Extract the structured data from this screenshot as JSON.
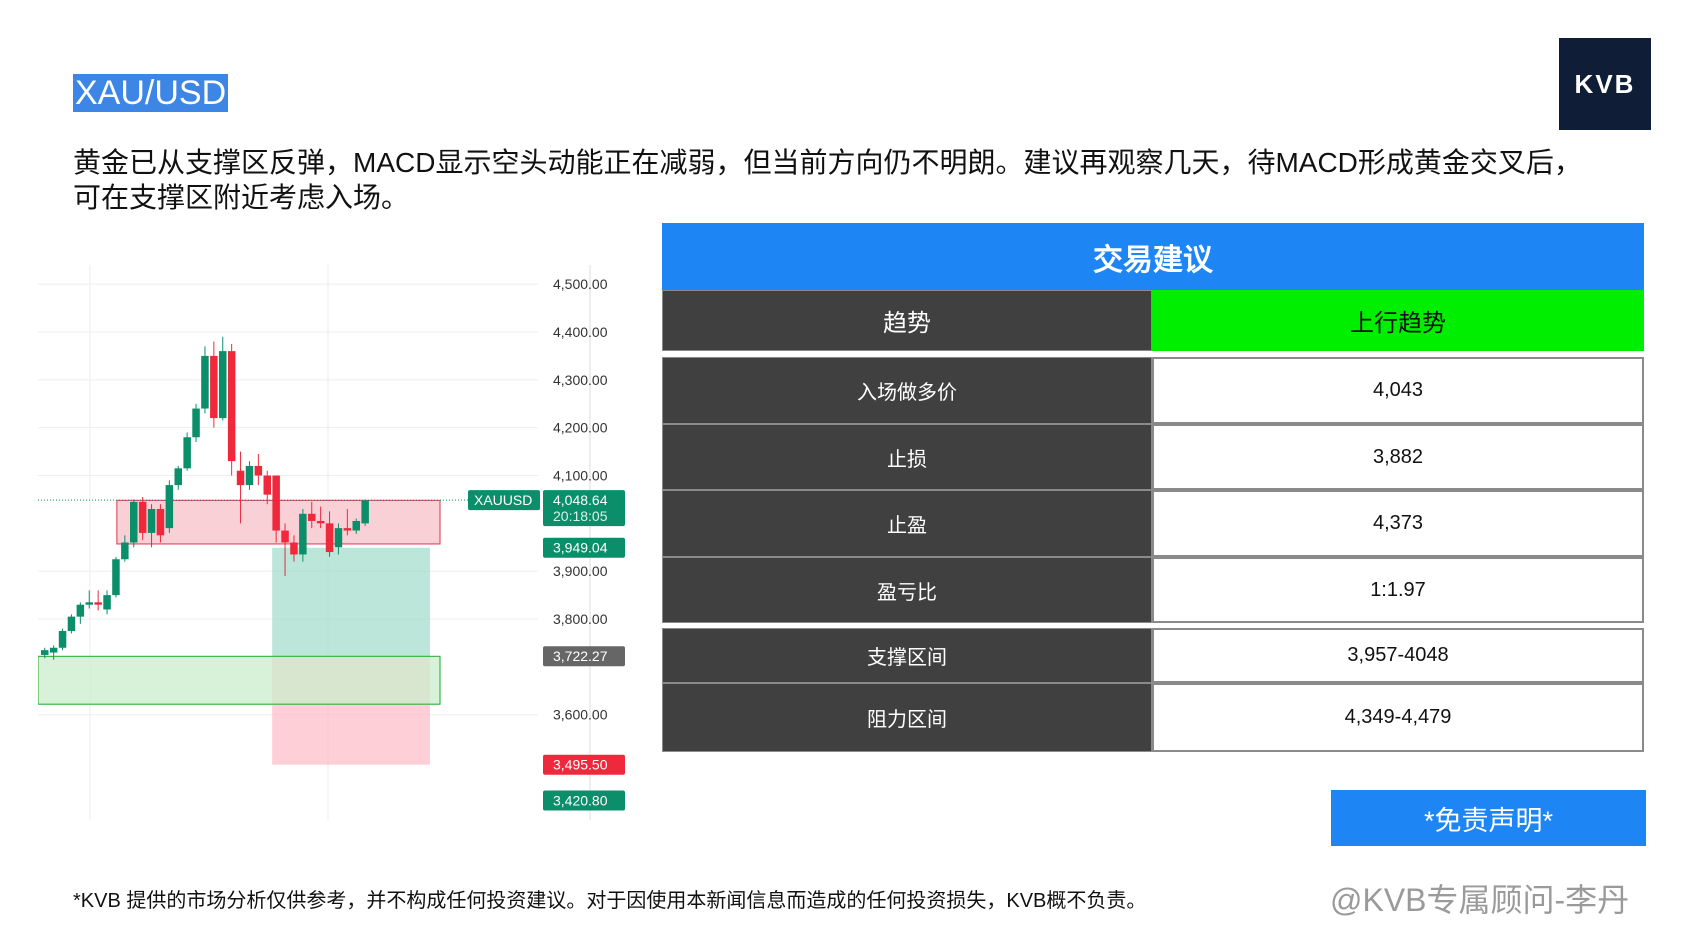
{
  "page": {
    "title": "XAU/USD",
    "description": "黄金已从支撑区反弹，MACD显示空头动能正在减弱，但当前方向仍不明朗。建议再观察几天，待MACD形成黄金交叉后，可在支撑区附近考虑入场。",
    "logo": "KVB",
    "footnote": "*KVB 提供的市场分析仅供参考，并不构成任何投资建议。对于因使用本新闻信息而造成的任何投资损失，KVB概不负责。",
    "watermark": "@KVB专属顾问-李丹",
    "disclaimer_button": "*免责声明*"
  },
  "panel": {
    "header": "交易建议",
    "trend_label": "趋势",
    "trend_value": "上行趋势",
    "rows": [
      {
        "label": "入场做多价",
        "value": "4,043"
      },
      {
        "label": "止损",
        "value": "3,882"
      },
      {
        "label": "止盈",
        "value": "4,373"
      },
      {
        "label": "盈亏比",
        "value": "1:1.97"
      },
      {
        "label": "支撑区间",
        "value": "3,957-4048"
      },
      {
        "label": "阻力区间",
        "value": "4,349-4,479"
      }
    ]
  },
  "chart_data": {
    "type": "candlestick",
    "symbol": "XAUUSD",
    "ylim": [
      3380,
      4540
    ],
    "ticks": [
      4500,
      4400,
      4300,
      4200,
      4100,
      3900,
      3800,
      3600
    ],
    "tick_labels": [
      "4,500.00",
      "4,400.00",
      "4,300.00",
      "4,200.00",
      "4,100.00",
      "3,900.00",
      "3,800.00",
      "3,600.00"
    ],
    "candles": [
      {
        "o": 3725,
        "h": 3740,
        "l": 3718,
        "c": 3735
      },
      {
        "o": 3730,
        "h": 3745,
        "l": 3715,
        "c": 3740
      },
      {
        "o": 3740,
        "h": 3780,
        "l": 3735,
        "c": 3775
      },
      {
        "o": 3775,
        "h": 3810,
        "l": 3770,
        "c": 3805
      },
      {
        "o": 3805,
        "h": 3835,
        "l": 3790,
        "c": 3830
      },
      {
        "o": 3830,
        "h": 3860,
        "l": 3822,
        "c": 3835
      },
      {
        "o": 3835,
        "h": 3860,
        "l": 3818,
        "c": 3830
      },
      {
        "o": 3820,
        "h": 3860,
        "l": 3810,
        "c": 3850
      },
      {
        "o": 3850,
        "h": 3930,
        "l": 3845,
        "c": 3925
      },
      {
        "o": 3925,
        "h": 3975,
        "l": 3920,
        "c": 3960
      },
      {
        "o": 3960,
        "h": 4050,
        "l": 3950,
        "c": 4045
      },
      {
        "o": 4045,
        "h": 4055,
        "l": 3965,
        "c": 3980
      },
      {
        "o": 3980,
        "h": 4040,
        "l": 3950,
        "c": 4030
      },
      {
        "o": 4030,
        "h": 4040,
        "l": 3960,
        "c": 3975
      },
      {
        "o": 3990,
        "h": 4090,
        "l": 3980,
        "c": 4080
      },
      {
        "o": 4080,
        "h": 4120,
        "l": 4070,
        "c": 4115
      },
      {
        "o": 4115,
        "h": 4190,
        "l": 4110,
        "c": 4180
      },
      {
        "o": 4180,
        "h": 4250,
        "l": 4170,
        "c": 4240
      },
      {
        "o": 4240,
        "h": 4370,
        "l": 4230,
        "c": 4350
      },
      {
        "o": 4350,
        "h": 4380,
        "l": 4200,
        "c": 4220
      },
      {
        "o": 4220,
        "h": 4390,
        "l": 4215,
        "c": 4360
      },
      {
        "o": 4360,
        "h": 4375,
        "l": 4100,
        "c": 4130
      },
      {
        "o": 4110,
        "h": 4150,
        "l": 4000,
        "c": 4080
      },
      {
        "o": 4080,
        "h": 4130,
        "l": 4070,
        "c": 4120
      },
      {
        "o": 4120,
        "h": 4145,
        "l": 4080,
        "c": 4100
      },
      {
        "o": 4100,
        "h": 4110,
        "l": 4040,
        "c": 4060
      },
      {
        "o": 4100,
        "h": 4100,
        "l": 3960,
        "c": 3985
      },
      {
        "o": 3985,
        "h": 4000,
        "l": 3890,
        "c": 3960
      },
      {
        "o": 3960,
        "h": 3975,
        "l": 3920,
        "c": 3935
      },
      {
        "o": 3935,
        "h": 4030,
        "l": 3920,
        "c": 4020
      },
      {
        "o": 4020,
        "h": 4045,
        "l": 3990,
        "c": 4005
      },
      {
        "o": 4005,
        "h": 4035,
        "l": 3990,
        "c": 4000
      },
      {
        "o": 4000,
        "h": 4025,
        "l": 3930,
        "c": 3940
      },
      {
        "o": 3950,
        "h": 4000,
        "l": 3935,
        "c": 3990
      },
      {
        "o": 3990,
        "h": 4030,
        "l": 3975,
        "c": 3985
      },
      {
        "o": 3985,
        "h": 4010,
        "l": 3978,
        "c": 4005
      },
      {
        "o": 4000,
        "h": 4050,
        "l": 3995,
        "c": 4048
      }
    ],
    "zones": [
      {
        "name": "resistance-zone",
        "y1": 3957,
        "y2": 4048,
        "color": "#f7c0c8"
      },
      {
        "name": "support-zone",
        "y1": 3622,
        "y2": 3722,
        "color": "#cbeccc"
      }
    ],
    "position": {
      "entry": 3949.04,
      "take_profit": 3722.27,
      "stop": 3495.5,
      "tp_top": 3949.04,
      "sl_bottom": 3495.5
    },
    "price_labels": [
      {
        "value": 4048.64,
        "text": "4,048.64",
        "sub": "20:18:05",
        "color": "#0a8f6a"
      },
      {
        "value": 3949.04,
        "text": "3,949.04",
        "color": "#0a8f6a"
      },
      {
        "value": 3722.27,
        "text": "3,722.27",
        "color": "#666666"
      },
      {
        "value": 3495.5,
        "text": "3,495.50",
        "color": "#f0283c"
      },
      {
        "value": 3420.8,
        "text": "3,420.80",
        "color": "#0a8f6a"
      }
    ],
    "up_color": "#0a8f6a",
    "down_color": "#f0283c"
  }
}
